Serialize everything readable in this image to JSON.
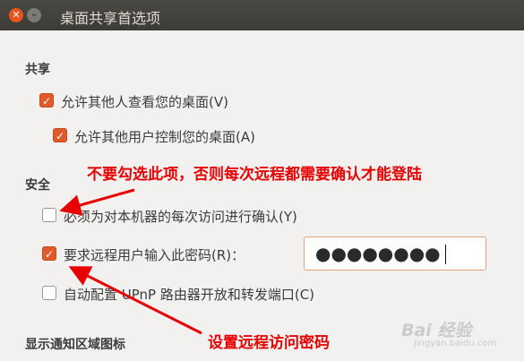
{
  "window": {
    "title": "桌面共享首选项",
    "close_glyph": "✕",
    "minimize_glyph": "–"
  },
  "sections": {
    "sharing": "共享",
    "security": "安全",
    "notification": "显示通知区域图标"
  },
  "options": {
    "allow_view": {
      "label": "允许其他人查看您的桌面(V)",
      "checked": true
    },
    "allow_control": {
      "label": "允许其他用户控制您的桌面(A)",
      "checked": true
    },
    "confirm_access": {
      "label": "必须为对本机器的每次访问进行确认(Y)",
      "checked": false
    },
    "require_password": {
      "label": "要求远程用户输入此密码(R)：",
      "checked": true
    },
    "upnp": {
      "label": "自动配置 UPnP 路由器开放和转发端口(C)",
      "checked": false
    }
  },
  "password": {
    "value": "●●●●●●●●"
  },
  "annotations": {
    "note_confirm": "不要勾选此项，否则每次远程都需要确认才能登陆",
    "note_password": "设置远程访问密码",
    "color": "#e60000"
  },
  "watermark": {
    "text": "Bai 经验",
    "sub": "jingyan.baidu.com"
  }
}
